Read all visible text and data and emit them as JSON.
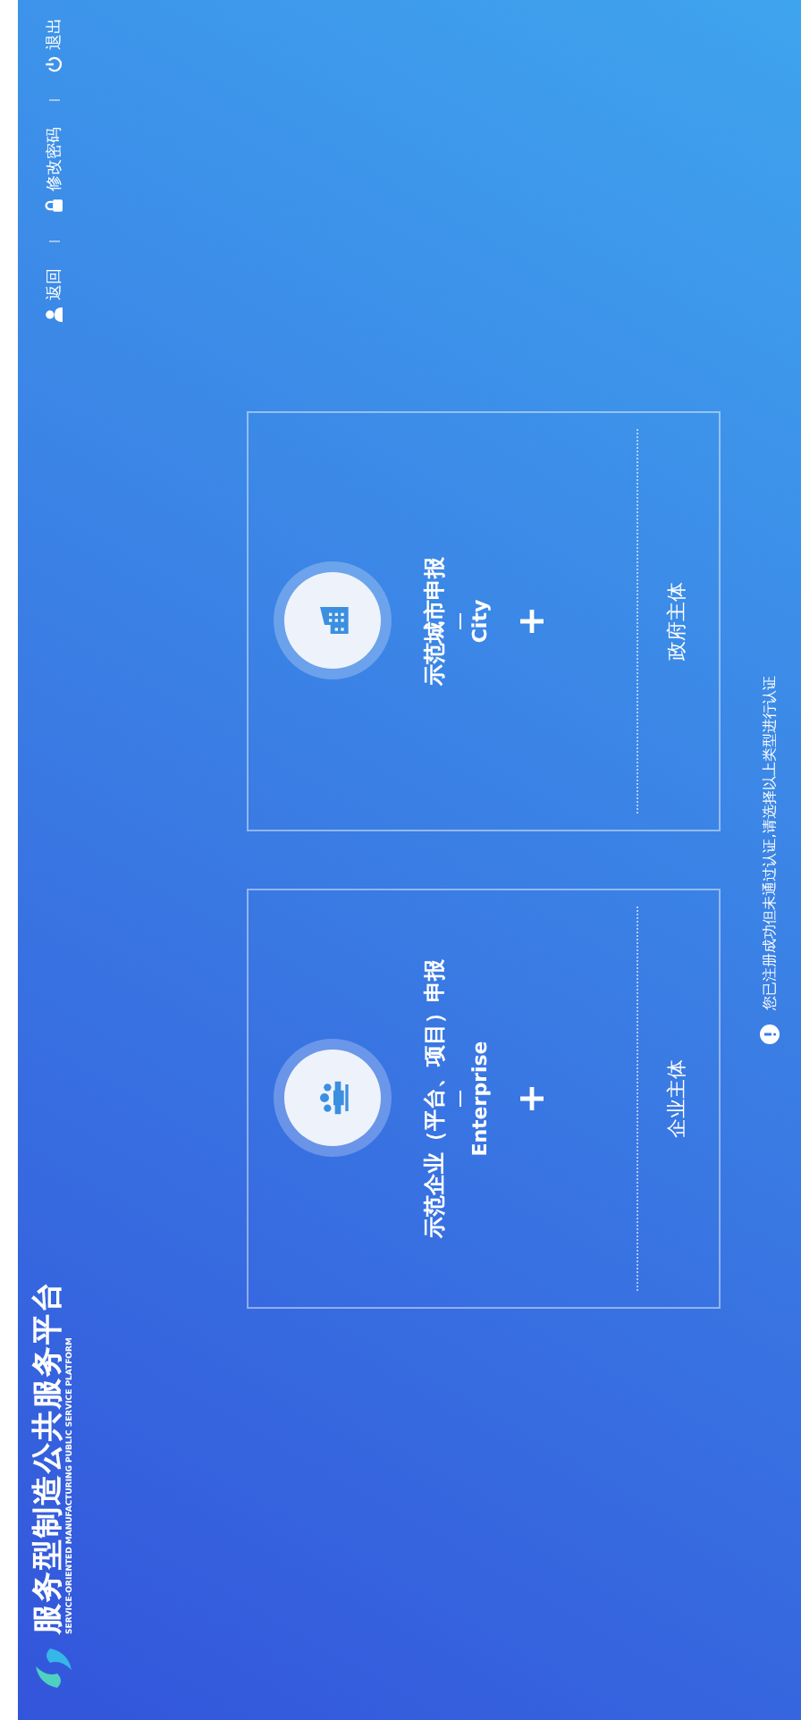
{
  "header": {
    "logo": {
      "title": "服务型制造公共服务平台",
      "subtitle": "SERVICE-ORIENTED MANUFACTURING PUBLIC SERVICE PLATFORM"
    },
    "nav": [
      {
        "label": "返回",
        "kind": "user"
      },
      {
        "label": "修改密码",
        "kind": "lock"
      },
      {
        "label": "退出",
        "kind": "power"
      }
    ]
  },
  "cards": [
    {
      "kind": "team",
      "title": "示范企业（平台、项目）申报",
      "subtitle": "Enterprise",
      "footer": "企业主体"
    },
    {
      "kind": "building",
      "title": "示范城市申报",
      "subtitle": "City",
      "footer": "政府主体"
    }
  ],
  "notice": "您已注册成功但未通过认证,请选择以上类型进行认证"
}
